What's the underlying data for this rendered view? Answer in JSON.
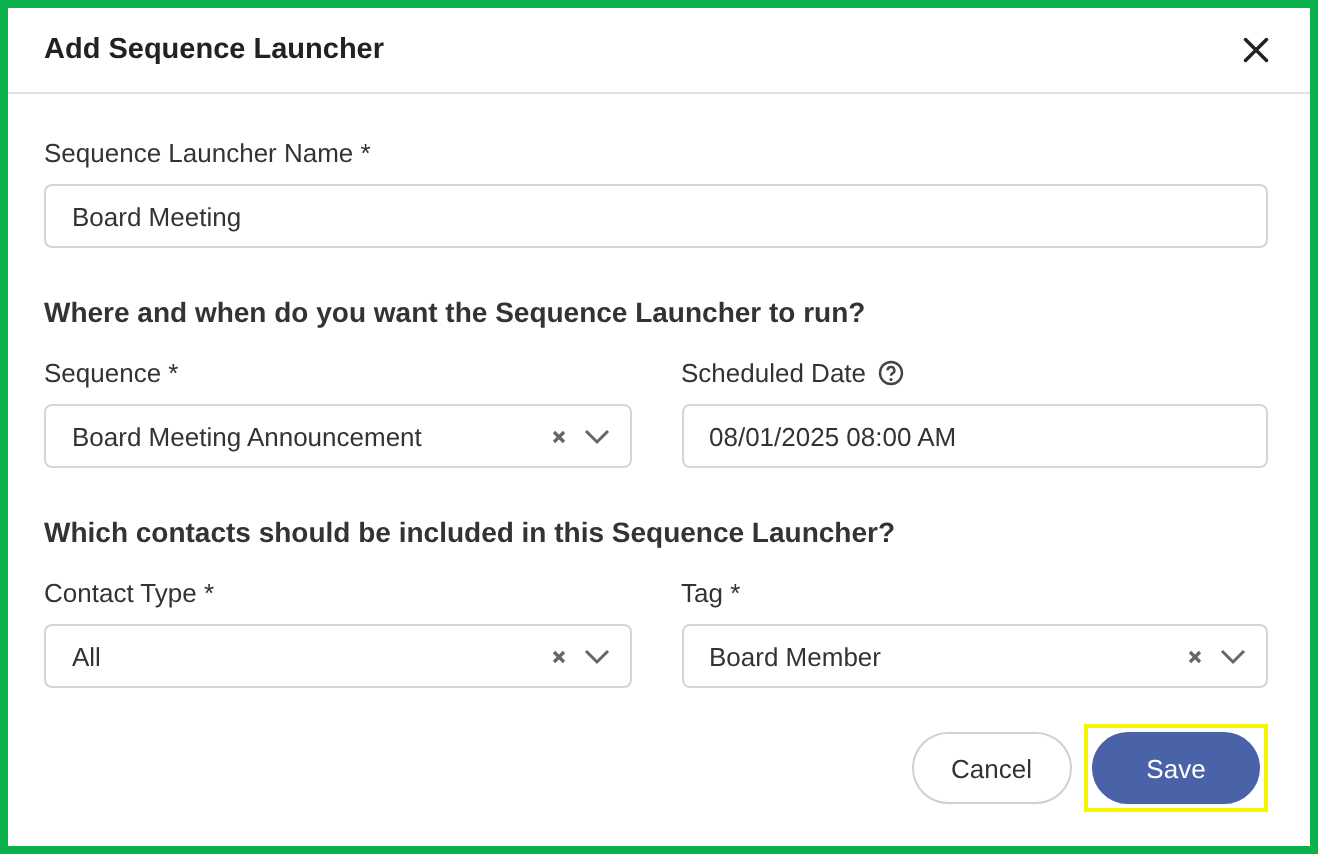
{
  "dialog": {
    "title": "Add Sequence Launcher"
  },
  "sections": [
    {
      "rows": [
        [
          {
            "kind": "text",
            "label": "Sequence Launcher Name *",
            "value": "Board Meeting"
          }
        ]
      ]
    },
    {
      "heading": "Where and when do you want the Sequence Launcher to run?",
      "rows": [
        [
          {
            "kind": "select",
            "label": "Sequence *",
            "value": "Board Meeting Announcement"
          },
          {
            "kind": "date",
            "label": "Scheduled Date",
            "help": true,
            "value": "08/01/2025 08:00 AM"
          }
        ]
      ]
    },
    {
      "heading": "Which contacts should be included in this Sequence Launcher?",
      "rows": [
        [
          {
            "kind": "select",
            "label": "Contact Type *",
            "value": "All"
          },
          {
            "kind": "select",
            "label": "Tag *",
            "value": "Board Member"
          }
        ]
      ]
    }
  ],
  "buttons": [
    {
      "label": "Cancel",
      "kind": "secondary",
      "highlighted": false
    },
    {
      "label": "Save",
      "kind": "primary",
      "highlighted": true
    }
  ]
}
